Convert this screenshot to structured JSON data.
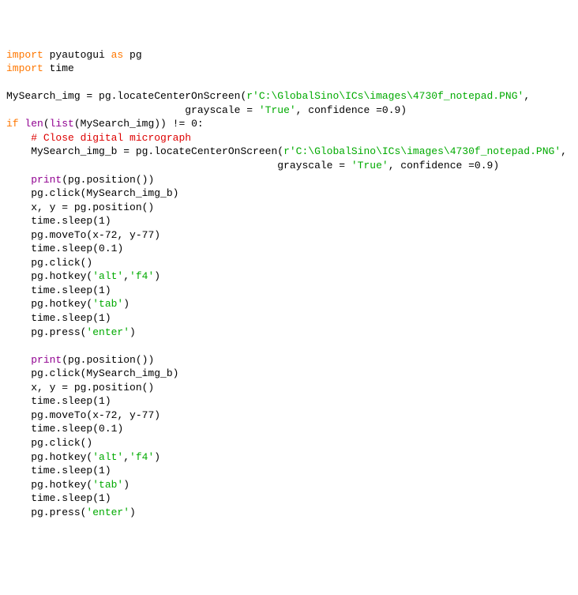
{
  "tokens": [
    {
      "t": "import ",
      "c": "kw"
    },
    {
      "t": "pyautogui ",
      "c": "name"
    },
    {
      "t": "as ",
      "c": "kw"
    },
    {
      "t": "pg",
      "c": "name"
    },
    {
      "t": "\n",
      "c": ""
    },
    {
      "t": "import ",
      "c": "kw"
    },
    {
      "t": "time",
      "c": "name"
    },
    {
      "t": "\n",
      "c": ""
    },
    {
      "t": "\n",
      "c": ""
    },
    {
      "t": "MySearch_img = pg.locateCenterOnScreen(",
      "c": "name"
    },
    {
      "t": "r'C:\\GlobalSino\\ICs\\images\\4730f_notepad.PNG'",
      "c": "str"
    },
    {
      "t": ",",
      "c": "name"
    },
    {
      "t": "\n",
      "c": ""
    },
    {
      "t": "                             grayscale = ",
      "c": "name"
    },
    {
      "t": "'True'",
      "c": "str"
    },
    {
      "t": ", confidence =",
      "c": "name"
    },
    {
      "t": "0.9",
      "c": "num"
    },
    {
      "t": ")",
      "c": "name"
    },
    {
      "t": "\n",
      "c": ""
    },
    {
      "t": "if ",
      "c": "kw"
    },
    {
      "t": "len",
      "c": "builtin"
    },
    {
      "t": "(",
      "c": "name"
    },
    {
      "t": "list",
      "c": "builtin"
    },
    {
      "t": "(MySearch_img)) != ",
      "c": "name"
    },
    {
      "t": "0",
      "c": "num"
    },
    {
      "t": ":",
      "c": "name"
    },
    {
      "t": "\n",
      "c": ""
    },
    {
      "t": "    ",
      "c": ""
    },
    {
      "t": "# Close digital micrograph",
      "c": "comment"
    },
    {
      "t": "\n",
      "c": ""
    },
    {
      "t": "    MySearch_img_b = pg.locateCenterOnScreen(",
      "c": "name"
    },
    {
      "t": "r'C:\\GlobalSino\\ICs\\images\\4730f_notepad.PNG'",
      "c": "str"
    },
    {
      "t": ",",
      "c": "name"
    },
    {
      "t": "\n",
      "c": ""
    },
    {
      "t": "                                            grayscale = ",
      "c": "name"
    },
    {
      "t": "'True'",
      "c": "str"
    },
    {
      "t": ", confidence =",
      "c": "name"
    },
    {
      "t": "0.9",
      "c": "num"
    },
    {
      "t": ")",
      "c": "name"
    },
    {
      "t": "\n",
      "c": ""
    },
    {
      "t": "    ",
      "c": ""
    },
    {
      "t": "print",
      "c": "builtin"
    },
    {
      "t": "(pg.position())",
      "c": "name"
    },
    {
      "t": "\n",
      "c": ""
    },
    {
      "t": "    pg.click(MySearch_img_b)",
      "c": "name"
    },
    {
      "t": "\n",
      "c": ""
    },
    {
      "t": "    x, y = pg.position()",
      "c": "name"
    },
    {
      "t": "\n",
      "c": ""
    },
    {
      "t": "    time.sleep(",
      "c": "name"
    },
    {
      "t": "1",
      "c": "num"
    },
    {
      "t": ")",
      "c": "name"
    },
    {
      "t": "\n",
      "c": ""
    },
    {
      "t": "    pg.moveTo(x-",
      "c": "name"
    },
    {
      "t": "72",
      "c": "num"
    },
    {
      "t": ", y-",
      "c": "name"
    },
    {
      "t": "77",
      "c": "num"
    },
    {
      "t": ")",
      "c": "name"
    },
    {
      "t": "\n",
      "c": ""
    },
    {
      "t": "    time.sleep(",
      "c": "name"
    },
    {
      "t": "0.1",
      "c": "num"
    },
    {
      "t": ")",
      "c": "name"
    },
    {
      "t": "\n",
      "c": ""
    },
    {
      "t": "    pg.click()",
      "c": "name"
    },
    {
      "t": "\n",
      "c": ""
    },
    {
      "t": "    pg.hotkey(",
      "c": "name"
    },
    {
      "t": "'alt'",
      "c": "str"
    },
    {
      "t": ",",
      "c": "name"
    },
    {
      "t": "'f4'",
      "c": "str"
    },
    {
      "t": ")",
      "c": "name"
    },
    {
      "t": "\n",
      "c": ""
    },
    {
      "t": "    time.sleep(",
      "c": "name"
    },
    {
      "t": "1",
      "c": "num"
    },
    {
      "t": ")",
      "c": "name"
    },
    {
      "t": "\n",
      "c": ""
    },
    {
      "t": "    pg.hotkey(",
      "c": "name"
    },
    {
      "t": "'tab'",
      "c": "str"
    },
    {
      "t": ")",
      "c": "name"
    },
    {
      "t": "\n",
      "c": ""
    },
    {
      "t": "    time.sleep(",
      "c": "name"
    },
    {
      "t": "1",
      "c": "num"
    },
    {
      "t": ")",
      "c": "name"
    },
    {
      "t": "\n",
      "c": ""
    },
    {
      "t": "    pg.press(",
      "c": "name"
    },
    {
      "t": "'enter'",
      "c": "str"
    },
    {
      "t": ")",
      "c": "name"
    },
    {
      "t": "\n",
      "c": ""
    },
    {
      "t": "\n",
      "c": ""
    },
    {
      "t": "    ",
      "c": ""
    },
    {
      "t": "print",
      "c": "builtin"
    },
    {
      "t": "(pg.position())",
      "c": "name"
    },
    {
      "t": "\n",
      "c": ""
    },
    {
      "t": "    pg.click(MySearch_img_b)",
      "c": "name"
    },
    {
      "t": "\n",
      "c": ""
    },
    {
      "t": "    x, y = pg.position()",
      "c": "name"
    },
    {
      "t": "\n",
      "c": ""
    },
    {
      "t": "    time.sleep(",
      "c": "name"
    },
    {
      "t": "1",
      "c": "num"
    },
    {
      "t": ")",
      "c": "name"
    },
    {
      "t": "\n",
      "c": ""
    },
    {
      "t": "    pg.moveTo(x-",
      "c": "name"
    },
    {
      "t": "72",
      "c": "num"
    },
    {
      "t": ", y-",
      "c": "name"
    },
    {
      "t": "77",
      "c": "num"
    },
    {
      "t": ")",
      "c": "name"
    },
    {
      "t": "\n",
      "c": ""
    },
    {
      "t": "    time.sleep(",
      "c": "name"
    },
    {
      "t": "0.1",
      "c": "num"
    },
    {
      "t": ")",
      "c": "name"
    },
    {
      "t": "\n",
      "c": ""
    },
    {
      "t": "    pg.click()",
      "c": "name"
    },
    {
      "t": "\n",
      "c": ""
    },
    {
      "t": "    pg.hotkey(",
      "c": "name"
    },
    {
      "t": "'alt'",
      "c": "str"
    },
    {
      "t": ",",
      "c": "name"
    },
    {
      "t": "'f4'",
      "c": "str"
    },
    {
      "t": ")",
      "c": "name"
    },
    {
      "t": "\n",
      "c": ""
    },
    {
      "t": "    time.sleep(",
      "c": "name"
    },
    {
      "t": "1",
      "c": "num"
    },
    {
      "t": ")",
      "c": "name"
    },
    {
      "t": "\n",
      "c": ""
    },
    {
      "t": "    pg.hotkey(",
      "c": "name"
    },
    {
      "t": "'tab'",
      "c": "str"
    },
    {
      "t": ")",
      "c": "name"
    },
    {
      "t": "\n",
      "c": ""
    },
    {
      "t": "    time.sleep(",
      "c": "name"
    },
    {
      "t": "1",
      "c": "num"
    },
    {
      "t": ")",
      "c": "name"
    },
    {
      "t": "\n",
      "c": ""
    },
    {
      "t": "    pg.press(",
      "c": "name"
    },
    {
      "t": "'enter'",
      "c": "str"
    },
    {
      "t": ")",
      "c": "name"
    }
  ]
}
